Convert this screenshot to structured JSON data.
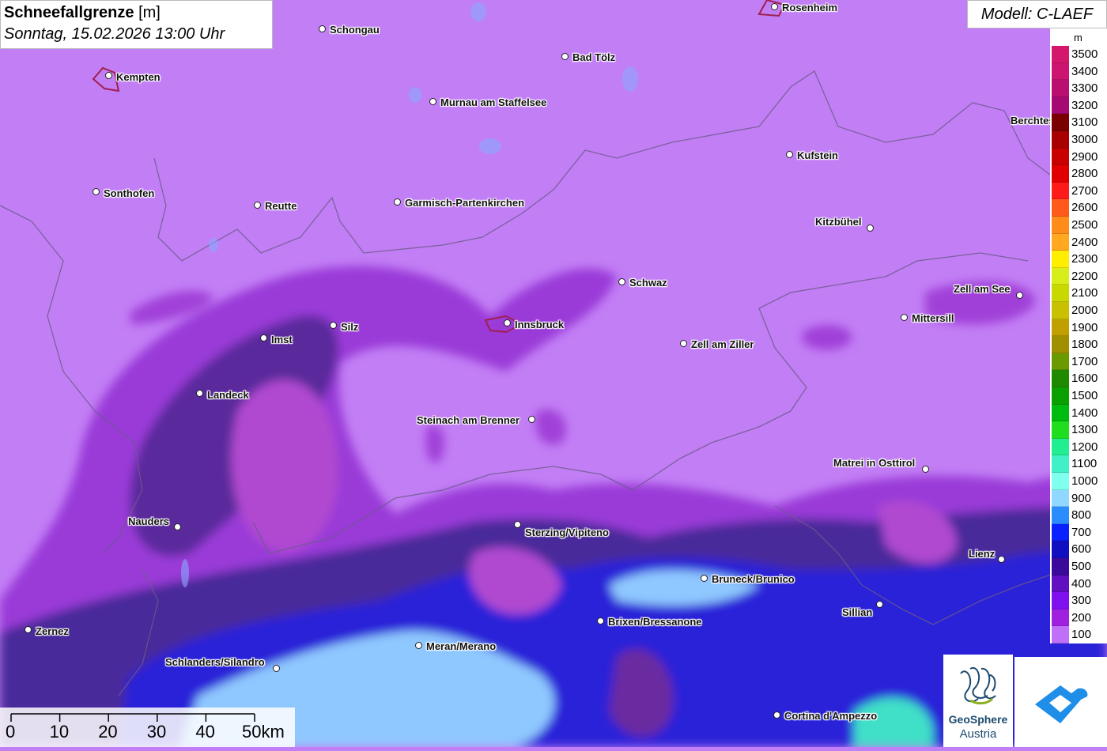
{
  "title": {
    "main_bold": "Schneefallgrenze",
    "main_unit": " [m]",
    "subtitle": "Sonntag, 15.02.2026 13:00 Uhr"
  },
  "model": "Modell: C-LAEF",
  "legend": {
    "unit": "m",
    "entries": [
      {
        "label": "3500",
        "color": "#d4166c"
      },
      {
        "label": "3400",
        "color": "#cc1470"
      },
      {
        "label": "3300",
        "color": "#bb0f6f"
      },
      {
        "label": "3200",
        "color": "#a40a72"
      },
      {
        "label": "3100",
        "color": "#7a0000"
      },
      {
        "label": "3000",
        "color": "#a80000"
      },
      {
        "label": "2900",
        "color": "#c80000"
      },
      {
        "label": "2800",
        "color": "#e00000"
      },
      {
        "label": "2700",
        "color": "#ff1a1a"
      },
      {
        "label": "2600",
        "color": "#ff5a1a"
      },
      {
        "label": "2500",
        "color": "#ff8c1a"
      },
      {
        "label": "2400",
        "color": "#ffa820"
      },
      {
        "label": "2300",
        "color": "#ffee00"
      },
      {
        "label": "2200",
        "color": "#d8ee1a"
      },
      {
        "label": "2100",
        "color": "#c8d800"
      },
      {
        "label": "2000",
        "color": "#c8c000"
      },
      {
        "label": "1900",
        "color": "#c0a000"
      },
      {
        "label": "1800",
        "color": "#a09000"
      },
      {
        "label": "1700",
        "color": "#6a9a00"
      },
      {
        "label": "1600",
        "color": "#1f8a00"
      },
      {
        "label": "1500",
        "color": "#0aa000"
      },
      {
        "label": "1400",
        "color": "#00bb10"
      },
      {
        "label": "1300",
        "color": "#20dd20"
      },
      {
        "label": "1200",
        "color": "#20ee90"
      },
      {
        "label": "1100",
        "color": "#40f0c8"
      },
      {
        "label": "1000",
        "color": "#80ffee"
      },
      {
        "label": "900",
        "color": "#90d8ff"
      },
      {
        "label": "800",
        "color": "#2a8cff"
      },
      {
        "label": "700",
        "color": "#0a20ff"
      },
      {
        "label": "600",
        "color": "#1010c0"
      },
      {
        "label": "500",
        "color": "#3a0a9a"
      },
      {
        "label": "400",
        "color": "#6010c0"
      },
      {
        "label": "300",
        "color": "#8010f0"
      },
      {
        "label": "200",
        "color": "#a020e0"
      },
      {
        "label": "100",
        "color": "#c070f8"
      }
    ]
  },
  "cities": [
    {
      "name": "Rosenheim",
      "dot": [
        980,
        9
      ],
      "label": [
        989,
        2
      ]
    },
    {
      "name": "Schongau",
      "dot": [
        408,
        37
      ],
      "label": [
        417,
        30
      ]
    },
    {
      "name": "Bad Tölz",
      "dot": [
        715,
        72
      ],
      "label": [
        724,
        65
      ]
    },
    {
      "name": "Kempten",
      "dot": [
        138,
        96
      ],
      "label": [
        147,
        90
      ]
    },
    {
      "name": "Murnau am Staffelsee",
      "dot": [
        548,
        129
      ],
      "label": [
        557,
        122
      ]
    },
    {
      "name": "Berchtesgaden",
      "dot": [
        1400,
        152
      ],
      "label": [
        1278,
        145
      ]
    },
    {
      "name": "Kufstein",
      "dot": [
        999,
        196
      ],
      "label": [
        1008,
        189
      ]
    },
    {
      "name": "Sonthofen",
      "dot": [
        122,
        243
      ],
      "label": [
        131,
        237
      ]
    },
    {
      "name": "Reutte",
      "dot": [
        326,
        260
      ],
      "label": [
        335,
        253
      ]
    },
    {
      "name": "Garmisch-Partenkirchen",
      "dot": [
        503,
        256
      ],
      "label": [
        512,
        249
      ]
    },
    {
      "name": "Kitzbühel",
      "dot": [
        1101,
        289
      ],
      "label": [
        1031,
        273
      ]
    },
    {
      "name": "Schwaz",
      "dot": [
        787,
        357
      ],
      "label": [
        796,
        350
      ]
    },
    {
      "name": "Zell am See",
      "dot": [
        1290,
        374
      ],
      "label": [
        1206,
        358
      ]
    },
    {
      "name": "Mittersill",
      "dot": [
        1144,
        402
      ],
      "label": [
        1153,
        395
      ]
    },
    {
      "name": "Silz",
      "dot": [
        422,
        412
      ],
      "label": [
        431,
        406
      ]
    },
    {
      "name": "Innsbruck",
      "dot": [
        642,
        409
      ],
      "label": [
        651,
        403
      ]
    },
    {
      "name": "Imst",
      "dot": [
        334,
        428
      ],
      "label": [
        343,
        422
      ]
    },
    {
      "name": "Zell am Ziller",
      "dot": [
        865,
        435
      ],
      "label": [
        874,
        428
      ]
    },
    {
      "name": "Landeck",
      "dot": [
        253,
        498
      ],
      "label": [
        262,
        492
      ]
    },
    {
      "name": "Steinach am Brenner",
      "dot": [
        673,
        531
      ],
      "label": [
        527,
        524
      ]
    },
    {
      "name": "Matrei in Osttirol",
      "dot": [
        1171,
        594
      ],
      "label": [
        1054,
        578
      ]
    },
    {
      "name": "Nauders",
      "dot": [
        225,
        667
      ],
      "label": [
        162,
        652
      ]
    },
    {
      "name": "Sterzing/Vipiteno",
      "dot": [
        655,
        664
      ],
      "label": [
        664,
        666
      ]
    },
    {
      "name": "Lienz",
      "dot": [
        1267,
        708
      ],
      "label": [
        1225,
        693
      ]
    },
    {
      "name": "Bruneck/Brunico",
      "dot": [
        891,
        732
      ],
      "label": [
        900,
        725
      ]
    },
    {
      "name": "Sillian",
      "dot": [
        1113,
        765
      ],
      "label": [
        1065,
        767
      ]
    },
    {
      "name": "Brixen/Bressanone",
      "dot": [
        760,
        786
      ],
      "label": [
        769,
        779
      ]
    },
    {
      "name": "Zernez",
      "dot": [
        36,
        797
      ],
      "label": [
        45,
        791
      ]
    },
    {
      "name": "Meran/Merano",
      "dot": [
        530,
        817
      ],
      "label": [
        539,
        810
      ]
    },
    {
      "name": "Schlanders/Silandro",
      "dot": [
        350,
        846
      ],
      "label": [
        209,
        830
      ]
    },
    {
      "name": "Cortina d'Ampezzo",
      "dot": [
        983,
        905
      ],
      "label": [
        992,
        898
      ]
    }
  ],
  "scale": {
    "labels": [
      "0",
      "10",
      "20",
      "30",
      "40",
      "50km"
    ]
  },
  "logos": {
    "geosphere_line1": "GeoSphere",
    "geosphere_line2": "Austria"
  }
}
